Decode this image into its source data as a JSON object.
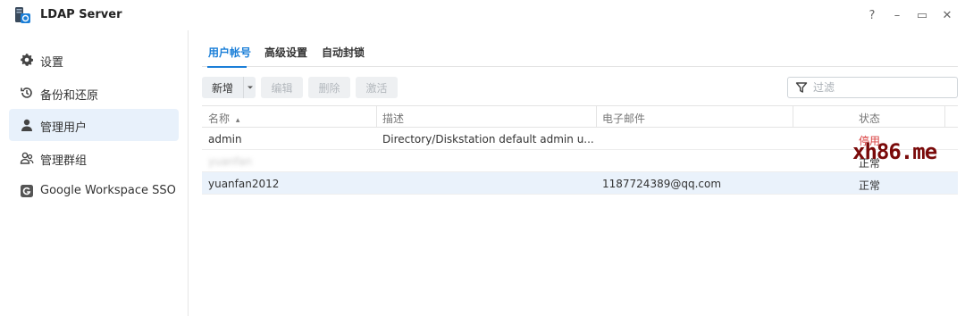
{
  "window": {
    "title": "LDAP Server",
    "controls": {
      "help": "?",
      "minimize": "–",
      "maximize": "▭",
      "close": "✕"
    }
  },
  "sidebar": {
    "items": [
      {
        "label": "设置",
        "icon": "gear-icon"
      },
      {
        "label": "备份和还原",
        "icon": "history-icon"
      },
      {
        "label": "管理用户",
        "icon": "user-icon",
        "active": true
      },
      {
        "label": "管理群组",
        "icon": "group-icon"
      },
      {
        "label": "Google Workspace SSO",
        "icon": "google-g-icon"
      }
    ]
  },
  "tabs": [
    {
      "label": "用户帐号",
      "active": true
    },
    {
      "label": "高级设置"
    },
    {
      "label": "自动封锁"
    }
  ],
  "toolbar": {
    "create": "新增",
    "edit": "编辑",
    "delete": "删除",
    "activate": "激活",
    "filter_placeholder": "过滤"
  },
  "table": {
    "columns": [
      "名称",
      "描述",
      "电子邮件",
      "状态"
    ],
    "sort_indicator": "▴",
    "rows": [
      {
        "name": "admin",
        "description": "Directory/Diskstation default admin u...",
        "email": "",
        "status": "停用",
        "status_color": "#d94040"
      },
      {
        "name": "yuanfan",
        "description": "",
        "email": "",
        "status": "正常",
        "blurred": true
      },
      {
        "name": "yuanfan2012",
        "description": "",
        "email": "1187724389@qq.com",
        "status": "正常",
        "selected": true
      }
    ]
  },
  "watermark": "xh86.me",
  "colors": {
    "accent": "#1b7fd8",
    "selected_row": "#eaf2fb",
    "sidebar_active": "#e8f1fb"
  }
}
